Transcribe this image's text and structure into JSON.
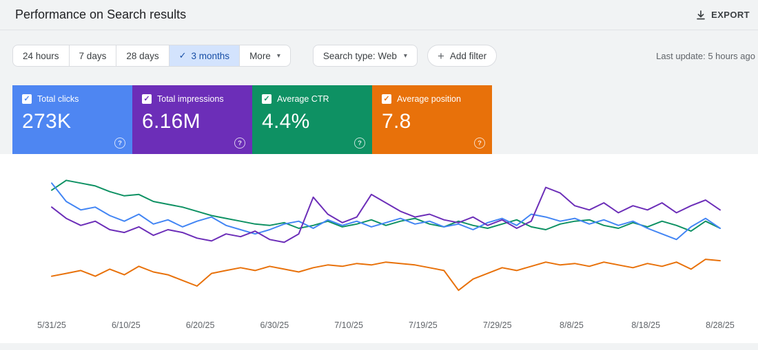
{
  "header": {
    "title": "Performance on Search results",
    "export_label": "EXPORT"
  },
  "filters": {
    "date_tabs": [
      {
        "label": "24 hours",
        "selected": false,
        "caret": false
      },
      {
        "label": "7 days",
        "selected": false,
        "caret": false
      },
      {
        "label": "28 days",
        "selected": false,
        "caret": false
      },
      {
        "label": "3 months",
        "selected": true,
        "caret": false
      },
      {
        "label": "More",
        "selected": false,
        "caret": true
      }
    ],
    "search_type": "Search type: Web",
    "add_filter": "Add filter",
    "last_update": "Last update: 5 hours ago"
  },
  "metrics": [
    {
      "label": "Total clicks",
      "value": "273K",
      "color": "#4e86f2",
      "checked": true
    },
    {
      "label": "Total impressions",
      "value": "6.16M",
      "color": "#6c2eb8",
      "checked": true
    },
    {
      "label": "Average CTR",
      "value": "4.4%",
      "color": "#0e9163",
      "checked": true
    },
    {
      "label": "Average position",
      "value": "7.8",
      "color": "#e8710a",
      "checked": true
    }
  ],
  "chart_data": {
    "type": "line",
    "title": "Performance on Search results",
    "x_tick_labels": [
      "5/31/25",
      "6/10/25",
      "6/20/25",
      "6/30/25",
      "7/10/25",
      "7/19/25",
      "7/29/25",
      "8/8/25",
      "8/18/25",
      "8/28/25"
    ],
    "x_range": [
      "5/31/25",
      "8/31/25"
    ],
    "y_axis": "hidden; each series normalized 0-100 of plot height",
    "grid": false,
    "legend_position": "metric cards act as legend toggles",
    "series": [
      {
        "name": "Total clicks",
        "color": "#4285f4",
        "values": [
          93,
          80,
          74,
          76,
          70,
          66,
          71,
          64,
          67,
          62,
          66,
          69,
          63,
          60,
          57,
          60,
          64,
          66,
          61,
          67,
          63,
          66,
          62,
          65,
          68,
          64,
          66,
          62,
          64,
          60,
          65,
          68,
          63,
          71,
          69,
          66,
          68,
          64,
          67,
          63,
          66,
          61,
          57,
          53,
          62,
          68,
          61
        ]
      },
      {
        "name": "Total impressions",
        "color": "#6c2eb8",
        "values": [
          76,
          68,
          63,
          66,
          60,
          58,
          62,
          56,
          60,
          58,
          54,
          52,
          57,
          55,
          59,
          53,
          51,
          57,
          83,
          71,
          65,
          69,
          85,
          79,
          73,
          69,
          71,
          67,
          65,
          69,
          63,
          67,
          61,
          66,
          90,
          86,
          77,
          74,
          79,
          72,
          77,
          74,
          79,
          72,
          77,
          81,
          74
        ]
      },
      {
        "name": "Average CTR",
        "color": "#0e9163",
        "values": [
          88,
          95,
          93,
          91,
          87,
          84,
          85,
          80,
          78,
          76,
          73,
          70,
          68,
          66,
          64,
          63,
          65,
          61,
          63,
          66,
          62,
          64,
          67,
          63,
          66,
          68,
          64,
          62,
          66,
          63,
          61,
          64,
          67,
          62,
          60,
          64,
          66,
          67,
          63,
          61,
          65,
          62,
          66,
          63,
          59,
          66,
          61
        ]
      },
      {
        "name": "Average position",
        "color": "#e8710a",
        "values": [
          27,
          29,
          31,
          27,
          32,
          28,
          34,
          30,
          28,
          24,
          20,
          29,
          31,
          33,
          31,
          34,
          32,
          30,
          33,
          35,
          34,
          36,
          35,
          37,
          36,
          35,
          33,
          31,
          17,
          25,
          29,
          33,
          31,
          34,
          37,
          35,
          36,
          34,
          37,
          35,
          33,
          36,
          34,
          37,
          32,
          39,
          38
        ]
      }
    ]
  }
}
